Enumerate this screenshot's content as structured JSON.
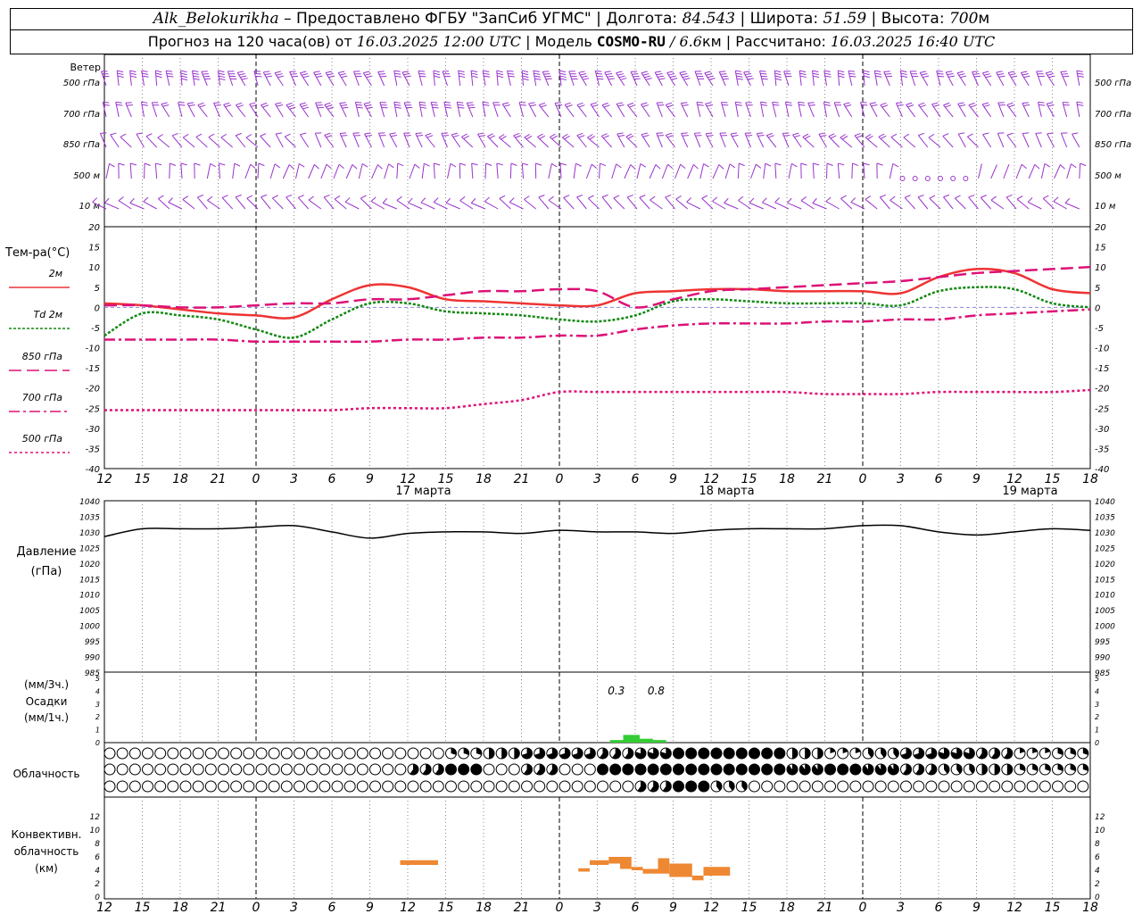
{
  "header": {
    "station": "Alk_Belokurikha",
    "provider": " – Предоставлено ФГБУ \"ЗапСиб УГМС\" | Долгота: ",
    "lon": "84.543",
    "lat_label": " | Широта: ",
    "lat": "51.59",
    "alt_label": " | Высота: ",
    "alt": "700",
    "alt_unit": "м",
    "forecast_prefix": "Прогноз на 120 часа(ов) от ",
    "start": "16.03.2025 12:00 UTC",
    "model_label": " | Модель ",
    "model": "COSMO-RU",
    "res": " / 6.6",
    "res_unit": "км",
    "calc_label": " | Рассчитано: ",
    "calc": "16.03.2025 16:40 UTC"
  },
  "colors": {
    "wind": "#9933cc",
    "t2m": "#ee3333",
    "td2m": "#118811",
    "t850": "#dd1177",
    "t700": "#dd1177",
    "t500": "#dd1177",
    "pressure": "#000000",
    "precip": "#33cc33",
    "convective": "#ee8833"
  },
  "wind_panel": {
    "title": "Ветер",
    "levels": [
      "500 гПа",
      "700 гПа",
      "850 гПа",
      "500 м",
      "10 м"
    ],
    "icon": "wind-barb-icon"
  },
  "temp_panel": {
    "title": "Тем-ра(°С)",
    "legend": [
      {
        "label": "2м",
        "key": "t2m",
        "dash": ""
      },
      {
        "label": "Td 2м",
        "key": "td2m",
        "dash": "3,2"
      },
      {
        "label": "850 гПа",
        "key": "t850",
        "dash": "14,6"
      },
      {
        "label": "700 гПа",
        "key": "t700",
        "dash": "12,4,3,4"
      },
      {
        "label": "500 гПа",
        "key": "t500",
        "dash": "3,3"
      }
    ]
  },
  "dates": [
    "17 марта",
    "18 марта",
    "19 марта"
  ],
  "pressure_panel": {
    "title": "Давление",
    "unit": "(гПа)"
  },
  "precip_panel": {
    "unit_3h": "(мм/3ч.)",
    "title": "Осадки",
    "unit_1h": "(мм/1ч.)",
    "labels": [
      "0.3",
      "0.8"
    ]
  },
  "cloud_panel": {
    "title": "Облачность"
  },
  "conv_panel": {
    "title_1": "Конвективн.",
    "title_2": "облачность",
    "unit": "(км)"
  },
  "chart_data": [
    {
      "type": "line",
      "title": "Тем-ра(°С)",
      "x_hours_utc": [
        12,
        15,
        18,
        21,
        0,
        3,
        6,
        9,
        12,
        15,
        18,
        21,
        0,
        3,
        6,
        9,
        12,
        15,
        18,
        21,
        0,
        3,
        6,
        9,
        12,
        15,
        18
      ],
      "ylim": [
        -40,
        20
      ],
      "yticks": [
        20,
        15,
        10,
        5,
        0,
        -5,
        -10,
        -15,
        -20,
        -25,
        -30,
        -35,
        -40
      ],
      "grid": false,
      "series": [
        {
          "name": "2м",
          "key": "t2m",
          "values": [
            1,
            0.5,
            -0.5,
            -1.5,
            -2,
            -2.5,
            2,
            5.5,
            5,
            2,
            1.5,
            1,
            0.5,
            0.5,
            3.5,
            4,
            4.5,
            4.5,
            4,
            4,
            4,
            3.5,
            7.5,
            9.5,
            8.5,
            4.5,
            3.5
          ]
        },
        {
          "name": "Td 2м",
          "key": "td2m",
          "values": [
            -7,
            -1.5,
            -2,
            -3,
            -5.5,
            -7.5,
            -3,
            1,
            1,
            -1,
            -1.5,
            -2,
            -3,
            -3.5,
            -2,
            1.5,
            2,
            1.5,
            1,
            1,
            1,
            0.5,
            4,
            5,
            4.5,
            1,
            0
          ]
        },
        {
          "name": "850 гПа",
          "key": "t850",
          "values": [
            0.5,
            0.5,
            0,
            0,
            0.5,
            1,
            1,
            2,
            2,
            3,
            4,
            4,
            4.5,
            4,
            0,
            2,
            4,
            4.5,
            5,
            5.5,
            6,
            6.5,
            7.5,
            8.5,
            9,
            9.5,
            10
          ]
        },
        {
          "name": "700 гПа",
          "key": "t700",
          "values": [
            -8,
            -8,
            -8,
            -8,
            -8.5,
            -8.5,
            -8.5,
            -8.5,
            -8,
            -8,
            -7.5,
            -7.5,
            -7,
            -7,
            -5.5,
            -4.5,
            -4,
            -4,
            -4,
            -3.5,
            -3.5,
            -3,
            -3,
            -2,
            -1.5,
            -1,
            -0.5
          ]
        },
        {
          "name": "500 гПа",
          "key": "t500",
          "values": [
            -25.5,
            -25.5,
            -25.5,
            -25.5,
            -25.5,
            -25.5,
            -25.5,
            -25,
            -25,
            -25,
            -24,
            -23,
            -21,
            -21,
            -21,
            -21,
            -21,
            -21,
            -21,
            -21.5,
            -21.5,
            -21.5,
            -21,
            -21,
            -21,
            -21,
            -20.5
          ]
        }
      ]
    },
    {
      "type": "line",
      "title": "Давление",
      "ylabel": "(гПа)",
      "x_hours_utc": [
        12,
        15,
        18,
        21,
        0,
        3,
        6,
        9,
        12,
        15,
        18,
        21,
        0,
        3,
        6,
        9,
        12,
        15,
        18,
        21,
        0,
        3,
        6,
        9,
        12,
        15,
        18
      ],
      "ylim": [
        985,
        1040
      ],
      "yticks": [
        1040,
        1035,
        1030,
        1025,
        1020,
        1015,
        1010,
        1005,
        1000,
        995,
        990,
        985
      ],
      "grid": false,
      "series": [
        {
          "name": "Давление",
          "key": "pressure",
          "values": [
            1028.5,
            1031,
            1031,
            1031,
            1031.5,
            1032,
            1030,
            1028,
            1029.5,
            1030,
            1030,
            1029.5,
            1030.5,
            1030,
            1030,
            1029.5,
            1030.5,
            1031,
            1031,
            1031,
            1032,
            1032,
            1030,
            1029,
            1030,
            1031,
            1030.5
          ]
        }
      ]
    },
    {
      "type": "bar",
      "title": "Осадки",
      "ylabel": "(мм/3ч.) (мм/1ч.)",
      "ylim": [
        0,
        5
      ],
      "yticks": [
        5,
        4,
        3,
        2,
        1,
        0
      ],
      "bars": [
        {
          "hour_index": 13.55,
          "width_h": 1.0,
          "value": 0.2
        },
        {
          "hour_index": 13.9,
          "width_h": 1.0,
          "value": 0.6
        },
        {
          "hour_index": 14.25,
          "width_h": 1.0,
          "value": 0.3
        },
        {
          "hour_index": 14.6,
          "width_h": 1.0,
          "value": 0.2
        }
      ],
      "annotations": [
        "0.3",
        "0.8"
      ]
    },
    {
      "type": "table",
      "title": "Облачность",
      "rows": [
        "upper",
        "middle",
        "lower"
      ],
      "cover_tenths_every_3h": {
        "upper": [
          0,
          0,
          0,
          0,
          0,
          0,
          0,
          0,
          0,
          3,
          5,
          7,
          7,
          6,
          8,
          10,
          10,
          10,
          5,
          2,
          4,
          7,
          8,
          6,
          2,
          3,
          5
        ],
        "middle": [
          0,
          0,
          0,
          0,
          0,
          0,
          0,
          0,
          6,
          10,
          0,
          6,
          0,
          10,
          10,
          10,
          10,
          10,
          9,
          10,
          9,
          6,
          4,
          5,
          3,
          3,
          3
        ],
        "lower": [
          0,
          0,
          0,
          0,
          0,
          0,
          0,
          0,
          0,
          0,
          0,
          0,
          0,
          0,
          6,
          10,
          4,
          0,
          0,
          0,
          0,
          0,
          0,
          0,
          0,
          0,
          0
        ]
      }
    },
    {
      "type": "bar",
      "title": "Конвективн. облачность",
      "ylabel": "(км)",
      "ylim": [
        0,
        14
      ],
      "yticks": [
        12,
        10,
        8,
        6,
        4,
        2,
        0
      ],
      "ranges_km": [
        {
          "from_h": 7.8,
          "to_h": 8.8,
          "base": 4.8,
          "top": 5.5
        },
        {
          "from_h": 12.5,
          "to_h": 12.8,
          "base": 3.8,
          "top": 4.3
        },
        {
          "from_h": 12.8,
          "to_h": 13.3,
          "base": 4.8,
          "top": 5.5
        },
        {
          "from_h": 13.3,
          "to_h": 13.6,
          "base": 5.0,
          "top": 6.0
        },
        {
          "from_h": 13.6,
          "to_h": 13.9,
          "base": 4.2,
          "top": 6.0
        },
        {
          "from_h": 13.9,
          "to_h": 14.2,
          "base": 4.0,
          "top": 4.5
        },
        {
          "from_h": 14.2,
          "to_h": 14.6,
          "base": 3.5,
          "top": 4.2
        },
        {
          "from_h": 14.6,
          "to_h": 14.9,
          "base": 3.5,
          "top": 5.8
        },
        {
          "from_h": 14.9,
          "to_h": 15.5,
          "base": 3.0,
          "top": 5.0
        },
        {
          "from_h": 15.5,
          "to_h": 15.8,
          "base": 2.5,
          "top": 3.2
        },
        {
          "from_h": 15.8,
          "to_h": 16.5,
          "base": 3.2,
          "top": 4.5
        }
      ]
    }
  ],
  "wind_data": {
    "note_levels": [
      "500 гПа",
      "700 гПа",
      "850 гПа",
      "500 м",
      "10 м"
    ],
    "speed_ms_every_3h": {
      "500 гПа": [
        15,
        17,
        18,
        18,
        17,
        16,
        16,
        15,
        14,
        14,
        15,
        18,
        20,
        22,
        25,
        23,
        20,
        18,
        17,
        16,
        15,
        14,
        14,
        14,
        15,
        16,
        16
      ],
      "700 гПа": [
        10,
        11,
        12,
        12,
        12,
        13,
        13,
        13,
        13,
        13,
        12,
        12,
        12,
        10,
        8,
        9,
        10,
        10,
        10,
        10,
        10,
        10,
        10,
        10,
        10,
        10,
        10
      ],
      "850 гПа": [
        6,
        7,
        7,
        7,
        7,
        7,
        8,
        8,
        8,
        8,
        8,
        8,
        8,
        8,
        8,
        9,
        9,
        9,
        9,
        8,
        8,
        7,
        7,
        7,
        7,
        6,
        6
      ],
      "500 м": [
        4,
        3,
        3,
        3,
        4,
        5,
        4,
        4,
        3,
        3,
        3,
        3,
        3,
        3,
        3,
        4,
        4,
        4,
        4,
        4,
        3,
        1,
        1,
        2,
        3,
        3,
        3
      ],
      "10 м": [
        4,
        4,
        4,
        4,
        4,
        4,
        4,
        4,
        4,
        4,
        4,
        4,
        4,
        4,
        4,
        4,
        4,
        4,
        4,
        4,
        4,
        4,
        4,
        4,
        4,
        4,
        4
      ]
    }
  }
}
